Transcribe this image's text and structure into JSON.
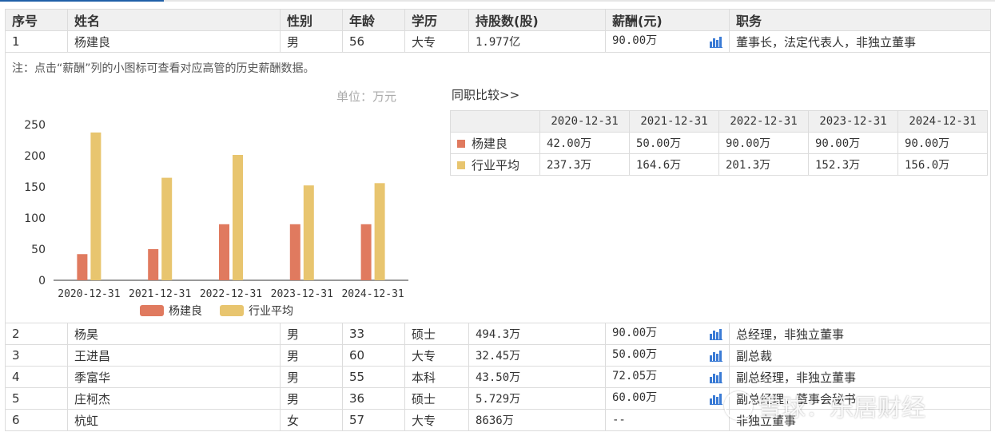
{
  "headers": [
    "序号",
    "姓名",
    "性别",
    "年龄",
    "学历",
    "持股数(股)",
    "薪酬(元)",
    "职务"
  ],
  "rows": [
    {
      "no": "1",
      "name": "杨建良",
      "gender": "男",
      "age": "56",
      "edu": "大专",
      "shares": "1.977亿",
      "salary": "90.00万",
      "title": "董事长，法定代表人，非独立董事",
      "has_chart_icon": true
    },
    {
      "no": "2",
      "name": "杨昊",
      "gender": "男",
      "age": "33",
      "edu": "硕士",
      "shares": "494.3万",
      "salary": "90.00万",
      "title": "总经理，非独立董事",
      "has_chart_icon": true
    },
    {
      "no": "3",
      "name": "王进昌",
      "gender": "男",
      "age": "60",
      "edu": "大专",
      "shares": "32.45万",
      "salary": "50.00万",
      "title": "副总裁",
      "has_chart_icon": true
    },
    {
      "no": "4",
      "name": "季富华",
      "gender": "男",
      "age": "55",
      "edu": "本科",
      "shares": "43.50万",
      "salary": "72.05万",
      "title": "副总经理，非独立董事",
      "has_chart_icon": true
    },
    {
      "no": "5",
      "name": "庄柯杰",
      "gender": "男",
      "age": "36",
      "edu": "硕士",
      "shares": "5.729万",
      "salary": "60.00万",
      "title": "副总经理，董事会秘书",
      "has_chart_icon": true
    },
    {
      "no": "6",
      "name": "杭虹",
      "gender": "女",
      "age": "57",
      "edu": "大专",
      "shares": "8636万",
      "salary": "--",
      "title": "非独立董事",
      "has_chart_icon": false
    }
  ],
  "detail": {
    "note": "注：点击“薪酬”列的小图标可查看对应高管的历史薪酬数据。",
    "unit": "单位：万元",
    "compare_title": "同职比较>>",
    "compare_headers": [
      "",
      "2020-12-31",
      "2021-12-31",
      "2022-12-31",
      "2023-12-31",
      "2024-12-31"
    ],
    "compare_rows": [
      {
        "label": "杨建良",
        "values": [
          "42.00万",
          "50.00万",
          "90.00万",
          "90.00万",
          "90.00万"
        ]
      },
      {
        "label": "行业平均",
        "values": [
          "237.3万",
          "164.6万",
          "201.3万",
          "152.3万",
          "156.0万"
        ]
      }
    ]
  },
  "chart_data": {
    "type": "bar",
    "categories": [
      "2020-12-31",
      "2021-12-31",
      "2022-12-31",
      "2023-12-31",
      "2024-12-31"
    ],
    "series": [
      {
        "name": "杨建良",
        "values": [
          42.0,
          50.0,
          90.0,
          90.0,
          90.0
        ],
        "color": "#e07a5f"
      },
      {
        "name": "行业平均",
        "values": [
          237.3,
          164.6,
          201.3,
          152.3,
          156.0
        ],
        "color": "#e8c56f"
      }
    ],
    "ylim": [
      0,
      250
    ],
    "yticks": [
      0,
      50,
      100,
      150,
      200,
      250
    ],
    "legend": "bottom",
    "grid": false
  },
  "watermark": "雪球：乐居财经",
  "colors": {
    "header_bg": "#f0f0f0",
    "border": "#dcdcdc",
    "accent": "#1f5fa8",
    "icon_blue": "#3a7bd5"
  }
}
